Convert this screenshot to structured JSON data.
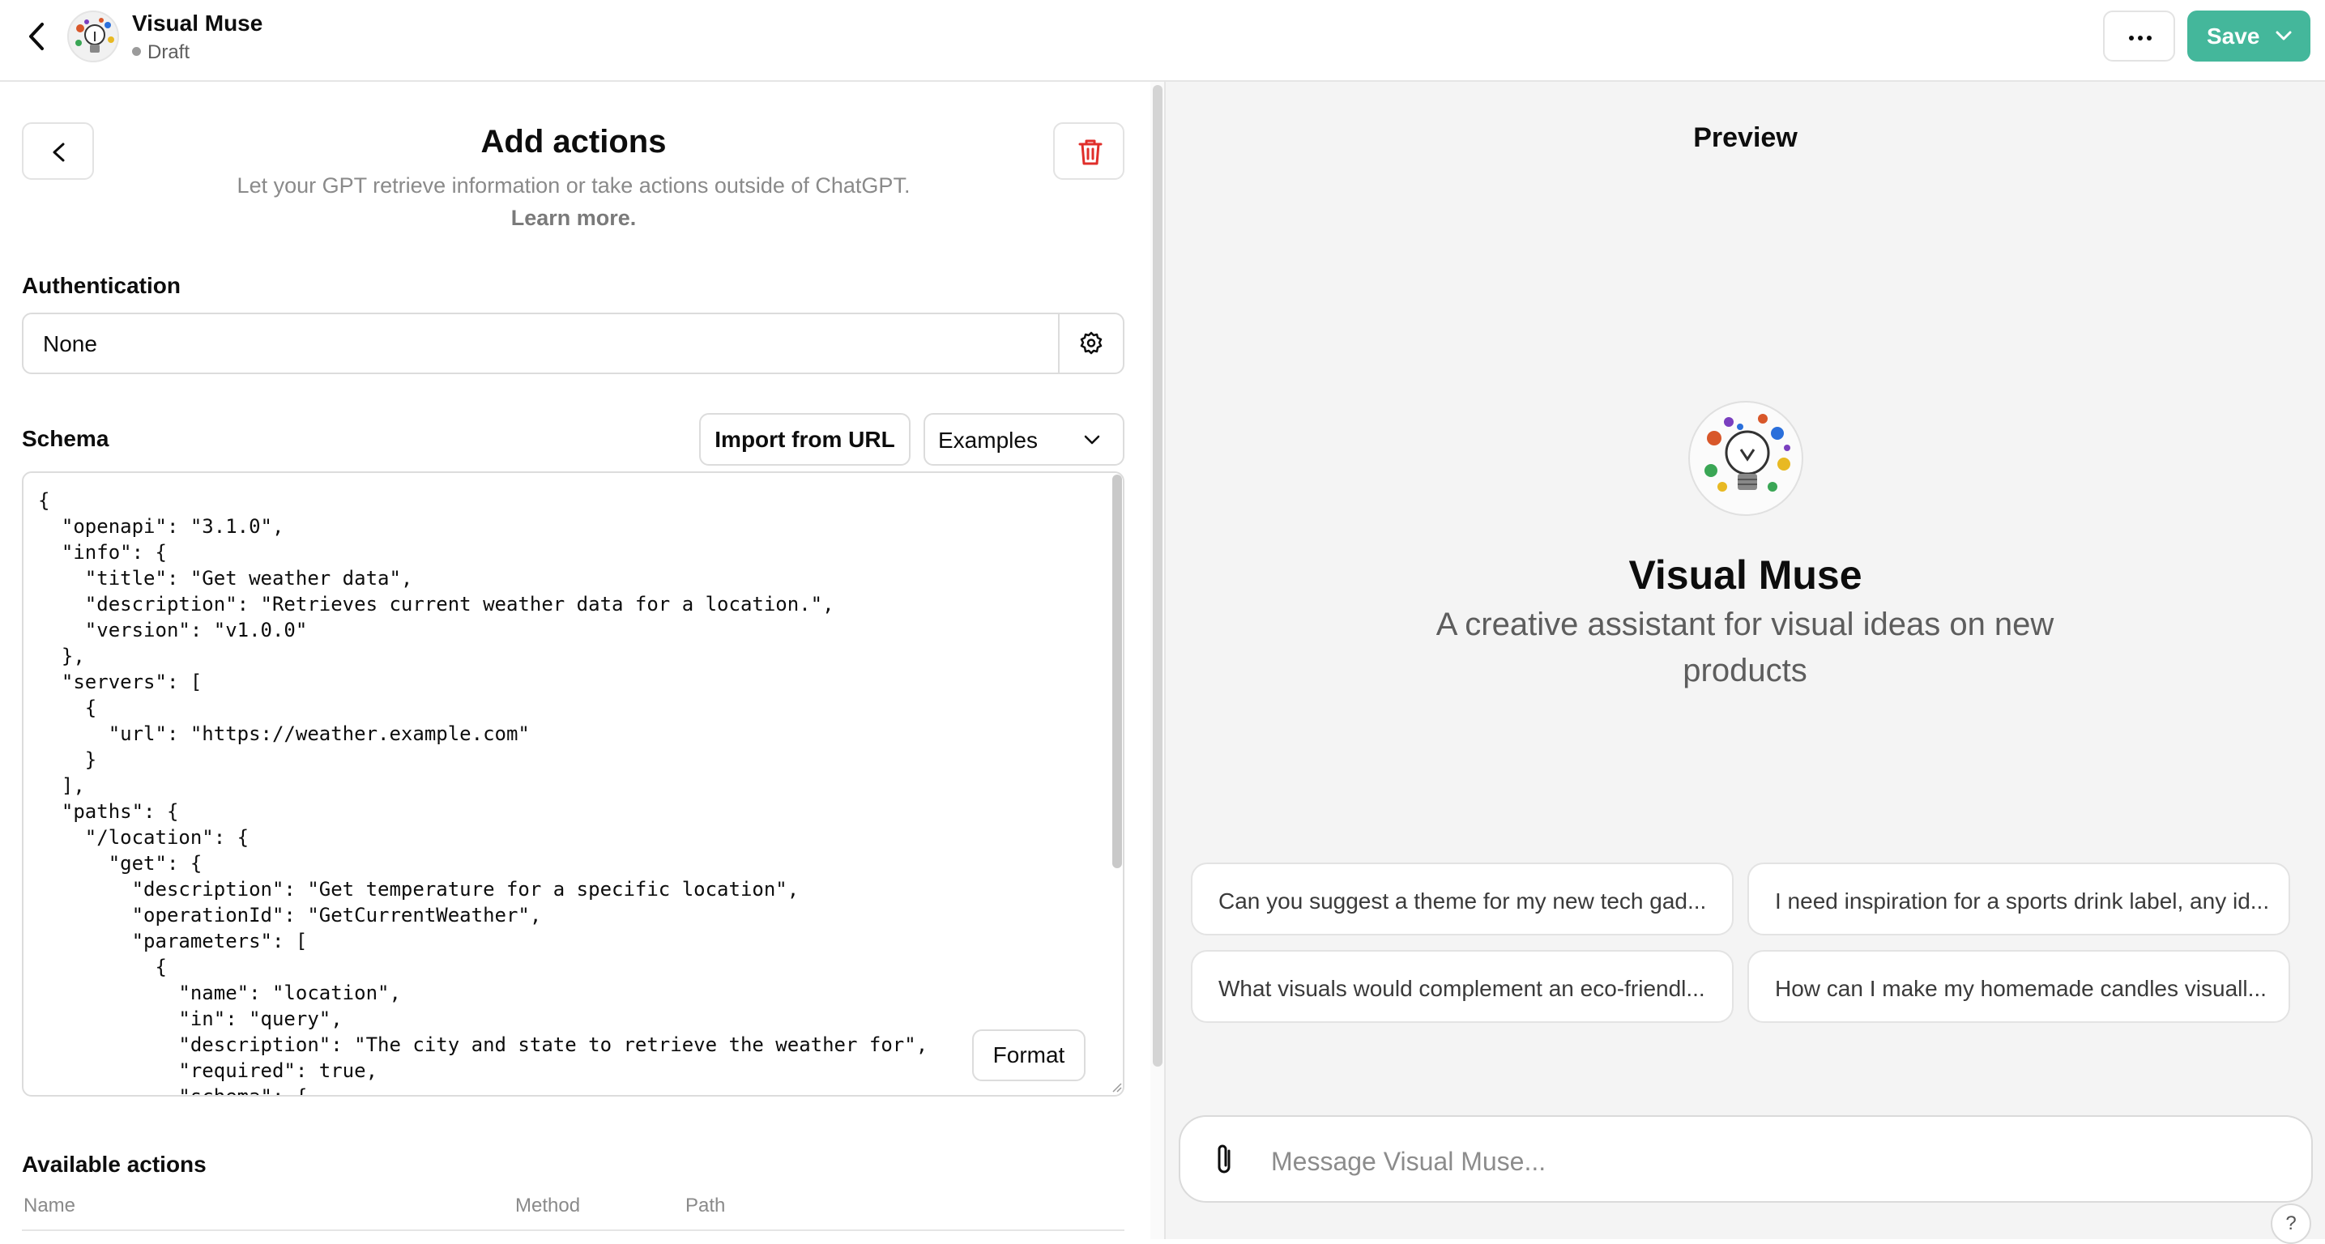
{
  "header": {
    "name": "Visual Muse",
    "status": "Draft",
    "save_label": "Save",
    "accent_color": "#10a37f"
  },
  "actions_panel": {
    "title": "Add actions",
    "subtitle": "Let your GPT retrieve information or take actions outside of ChatGPT.",
    "learn_more": "Learn more.",
    "authentication": {
      "label": "Authentication",
      "value": "None"
    },
    "schema": {
      "label": "Schema",
      "import_label": "Import from URL",
      "examples_label": "Examples",
      "format_label": "Format",
      "lines": [
        "{",
        "  \"openapi\": \"3.1.0\",",
        "  \"info\": {",
        "    \"title\": \"Get weather data\",",
        "    \"description\": \"Retrieves current weather data for a location.\",",
        "    \"version\": \"v1.0.0\"",
        "  },",
        "  \"servers\": [",
        "    {",
        "      \"url\": \"https://weather.example.com\"",
        "    }",
        "  ],",
        "  \"paths\": {",
        "    \"/location\": {",
        "      \"get\": {",
        "        \"description\": \"Get temperature for a specific location\",",
        "        \"operationId\": \"GetCurrentWeather\",",
        "        \"parameters\": [",
        "          {",
        "            \"name\": \"location\",",
        "            \"in\": \"query\",",
        "            \"description\": \"The city and state to retrieve the weather for\",",
        "            \"required\": true,",
        "            \"schema\": {"
      ]
    },
    "available_actions": {
      "label": "Available actions",
      "columns": [
        "Name",
        "Method",
        "Path"
      ]
    }
  },
  "preview": {
    "title": "Preview",
    "gpt_name": "Visual Muse",
    "gpt_description": "A creative assistant for visual ideas on new products",
    "suggestions": [
      "Can you suggest a theme for my new tech gad...",
      "I need inspiration for a sports drink label, any id...",
      "What visuals would complement an eco-friendl...",
      "How can I make my homemade candles visuall..."
    ],
    "composer_placeholder": "Message Visual Muse...",
    "help_label": "?"
  }
}
